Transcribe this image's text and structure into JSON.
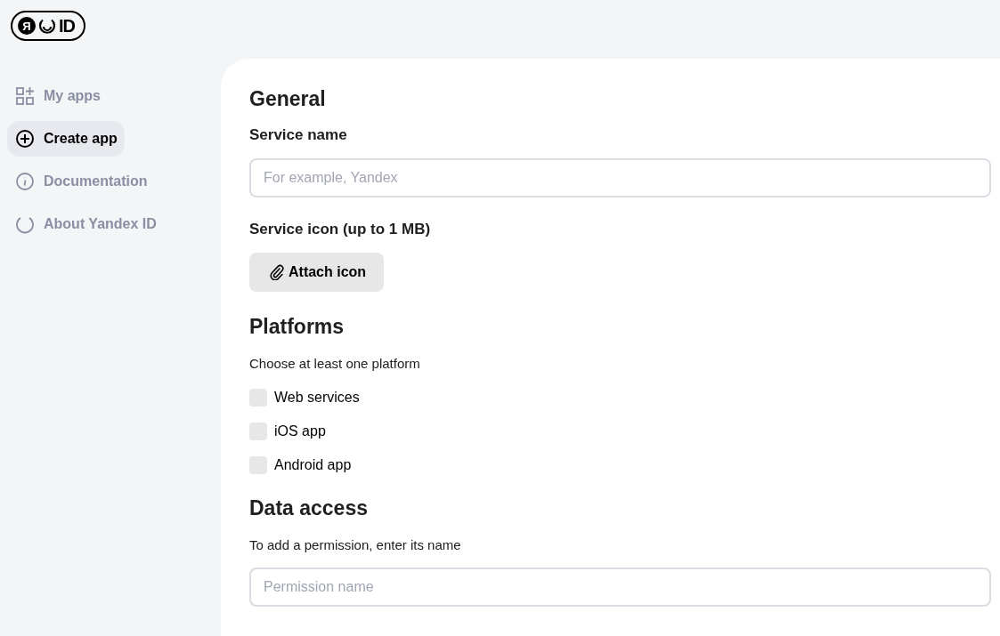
{
  "logo": {
    "letter": "Я",
    "text": "ID"
  },
  "sidebar": {
    "items": [
      {
        "label": "My apps",
        "selected": false
      },
      {
        "label": "Create app",
        "selected": true
      },
      {
        "label": "Documentation",
        "selected": false
      },
      {
        "label": "About Yandex ID",
        "selected": false
      }
    ]
  },
  "general": {
    "title": "General",
    "service_name_label": "Service name",
    "service_name_placeholder": "For example, Yandex",
    "icon_label": "Service icon (up to 1 MB)",
    "attach_button": "Attach icon"
  },
  "platforms": {
    "title": "Platforms",
    "hint": "Choose at least one platform",
    "options": [
      {
        "label": "Web services",
        "checked": false
      },
      {
        "label": "iOS app",
        "checked": false
      },
      {
        "label": "Android app",
        "checked": false
      }
    ]
  },
  "data_access": {
    "title": "Data access",
    "hint": "To add a permission, enter its name",
    "placeholder": "Permission name"
  }
}
